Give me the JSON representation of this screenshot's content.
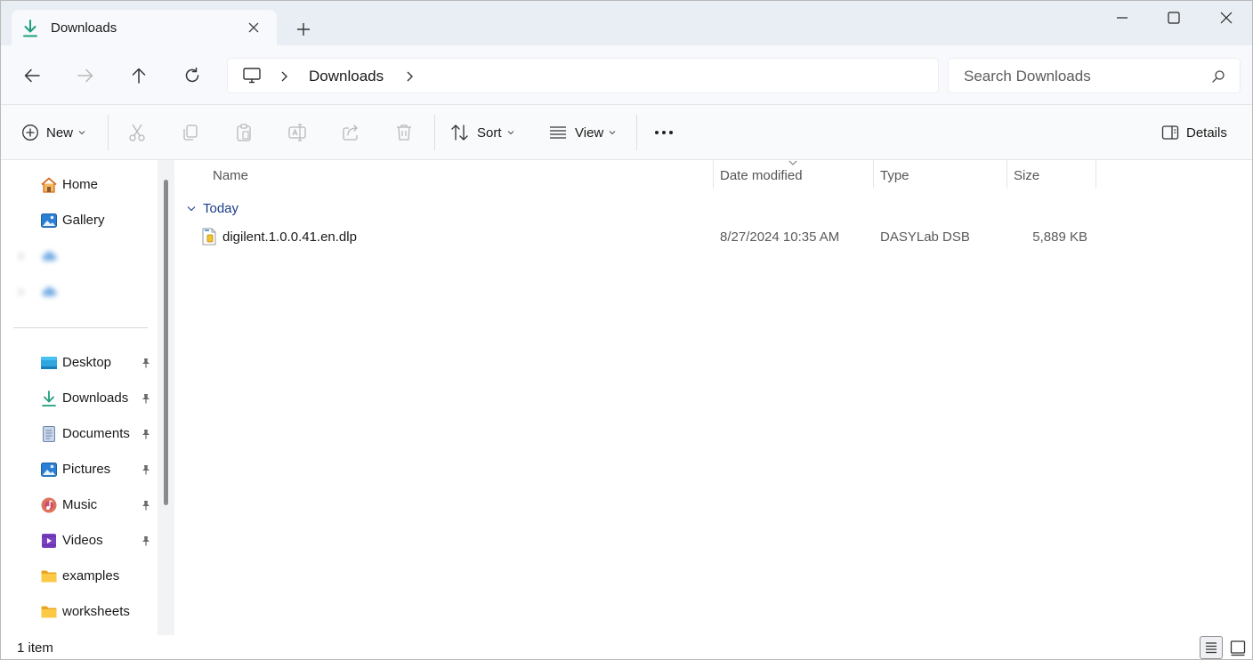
{
  "window": {
    "tab_title": "Downloads",
    "tab_icon": "download-icon",
    "new_tab_icon": "plus-icon",
    "controls": [
      "minimize-icon",
      "maximize-icon",
      "close-icon"
    ]
  },
  "address": {
    "nav_icons": [
      "back-arrow-icon",
      "forward-arrow-icon",
      "up-arrow-icon",
      "refresh-icon"
    ],
    "breadcrumb": {
      "root_icon": "computer-icon",
      "segments": [
        "Downloads"
      ]
    },
    "search_placeholder": "Search Downloads"
  },
  "commandbar": {
    "new_label": "New",
    "sort_label": "Sort",
    "view_label": "View",
    "details_label": "Details",
    "action_icons": [
      "cut-icon",
      "copy-icon",
      "paste-icon",
      "rename-icon",
      "share-icon",
      "delete-icon"
    ],
    "more_icon": "more-options-icon"
  },
  "sidebar": {
    "top_items": [
      {
        "label": "Home",
        "icon": "home-icon"
      },
      {
        "label": "Gallery",
        "icon": "gallery-icon"
      }
    ],
    "pinned_items": [
      {
        "label": "Desktop",
        "icon": "desktop-folder-icon",
        "pinned": true
      },
      {
        "label": "Downloads",
        "icon": "download-icon",
        "pinned": true
      },
      {
        "label": "Documents",
        "icon": "documents-icon",
        "pinned": true
      },
      {
        "label": "Pictures",
        "icon": "pictures-icon",
        "pinned": true
      },
      {
        "label": "Music",
        "icon": "music-icon",
        "pinned": true
      },
      {
        "label": "Videos",
        "icon": "videos-icon",
        "pinned": true
      },
      {
        "label": "examples",
        "icon": "folder-icon",
        "pinned": false
      },
      {
        "label": "worksheets",
        "icon": "folder-icon",
        "pinned": false
      }
    ]
  },
  "columns": {
    "name": "Name",
    "date_modified": "Date modified",
    "type": "Type",
    "size": "Size"
  },
  "groups": [
    {
      "label": "Today",
      "files": [
        {
          "name": "digilent.1.0.0.41.en.dlp",
          "date_modified": "8/27/2024 10:35 AM",
          "type": "DASYLab DSB",
          "size": "5,889 KB",
          "icon": "dlp-file-icon"
        }
      ]
    }
  ],
  "status": {
    "item_count": "1 item",
    "view_icons": [
      "details-view-icon",
      "tiles-view-icon"
    ]
  },
  "colors": {
    "accent": "#0067c0",
    "titlebar_bg": "#e9eef4",
    "group_text": "#1b3d8a"
  }
}
